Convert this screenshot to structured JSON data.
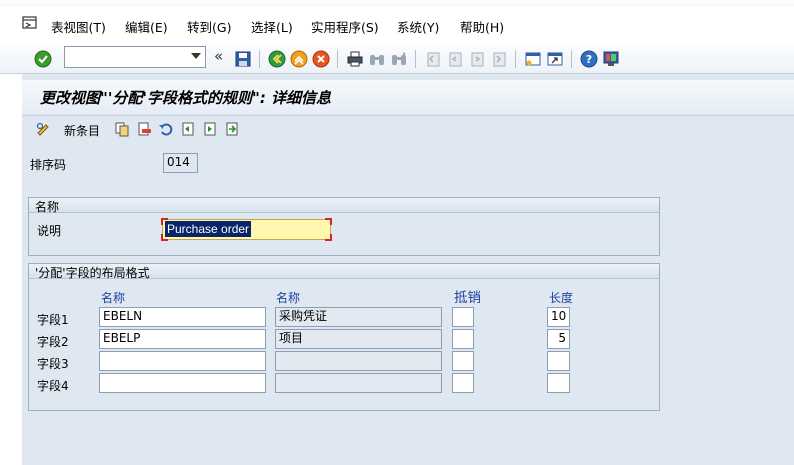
{
  "menubar": {
    "items": [
      "表视图(T)",
      "编辑(E)",
      "转到(G)",
      "选择(L)",
      "实用程序(S)",
      "系统(Y)",
      "帮助(H)"
    ]
  },
  "toolbar": {
    "command_field_value": "",
    "icons": [
      "enter-check-icon",
      "save-icon",
      "back-icon",
      "exit-icon",
      "cancel-icon",
      "print-icon",
      "find-icon",
      "find-next-icon",
      "first-page-icon",
      "prev-page-icon",
      "next-page-icon",
      "last-page-icon",
      "new-session-icon",
      "shortcut-icon",
      "help-icon",
      "layout-icon"
    ]
  },
  "page": {
    "title": "更改视图\"'分配'字段格式的规则\": 详细信息"
  },
  "app_toolbar": {
    "new_entries_label": "新条目"
  },
  "sort_code": {
    "label": "排序码",
    "value": "014"
  },
  "name_group": {
    "title": "名称",
    "description_label": "说明",
    "description_value": "Purchase order"
  },
  "layout_group": {
    "title": "'分配'字段的布局格式",
    "col_name1": "名称",
    "col_name2": "名称",
    "col_reverse": "抵销",
    "col_length": "长度",
    "rows": [
      {
        "label": "字段1",
        "field": "EBELN",
        "name": "采购凭证",
        "reverse": "",
        "length": "10"
      },
      {
        "label": "字段2",
        "field": "EBELP",
        "name": "项目",
        "reverse": "",
        "length": "5"
      },
      {
        "label": "字段3",
        "field": "",
        "name": "",
        "reverse": "",
        "length": ""
      },
      {
        "label": "字段4",
        "field": "",
        "name": "",
        "reverse": "",
        "length": ""
      }
    ]
  },
  "colors": {
    "background": "#dfe8f1",
    "selection": "#0a246a",
    "highlight_field": "#fff6b0",
    "column_header": "#1e3fa0"
  }
}
